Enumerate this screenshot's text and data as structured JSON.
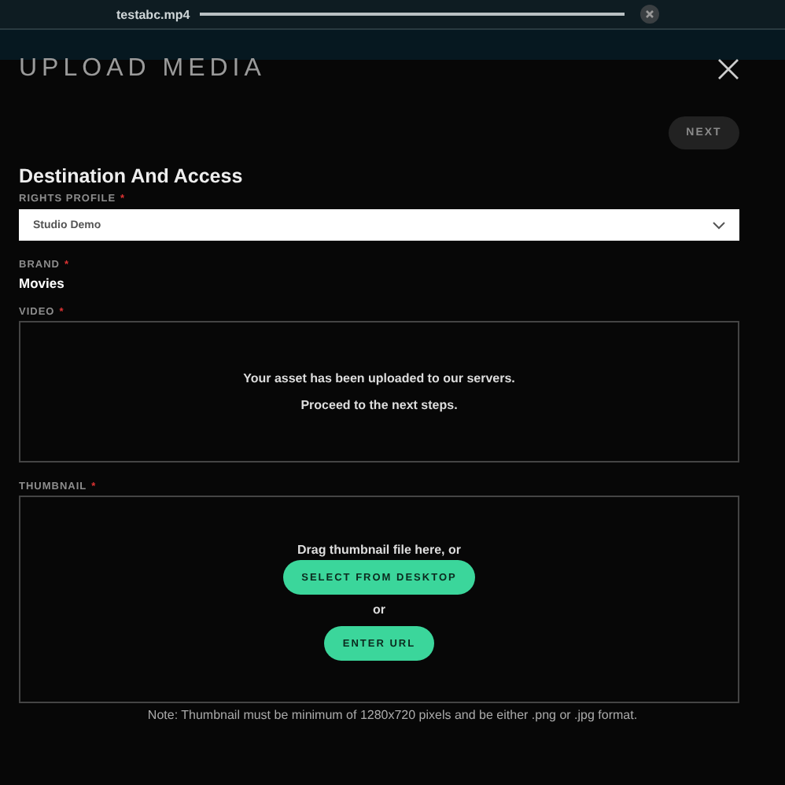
{
  "upload": {
    "file_name": "testabc.mp4",
    "level": 1
  },
  "title": "UPLOAD MEDIA",
  "next_button": "NEXT",
  "section_title": "Destination And Access",
  "rights_profile": {
    "label": "RIGHTS PROFILE",
    "required_mark": "*",
    "value": "Studio Demo"
  },
  "brand": {
    "label": "BRAND",
    "required_mark": "*",
    "value": "Movies"
  },
  "video": {
    "label": "VIDEO",
    "required_mark": "*",
    "messages": [
      "Your asset has been uploaded to our servers.",
      "Proceed to the next steps."
    ]
  },
  "thumbnail": {
    "label": "THUMBNAIL",
    "required_mark": "*",
    "prompt": "Drag thumbnail file here, or",
    "select_button": "SELECT FROM DESKTOP",
    "or": "or",
    "url_button": "ENTER URL"
  },
  "note": "Note: Thumbnail must be minimum of 1280x720 pixels and be either .png or .jpg format."
}
